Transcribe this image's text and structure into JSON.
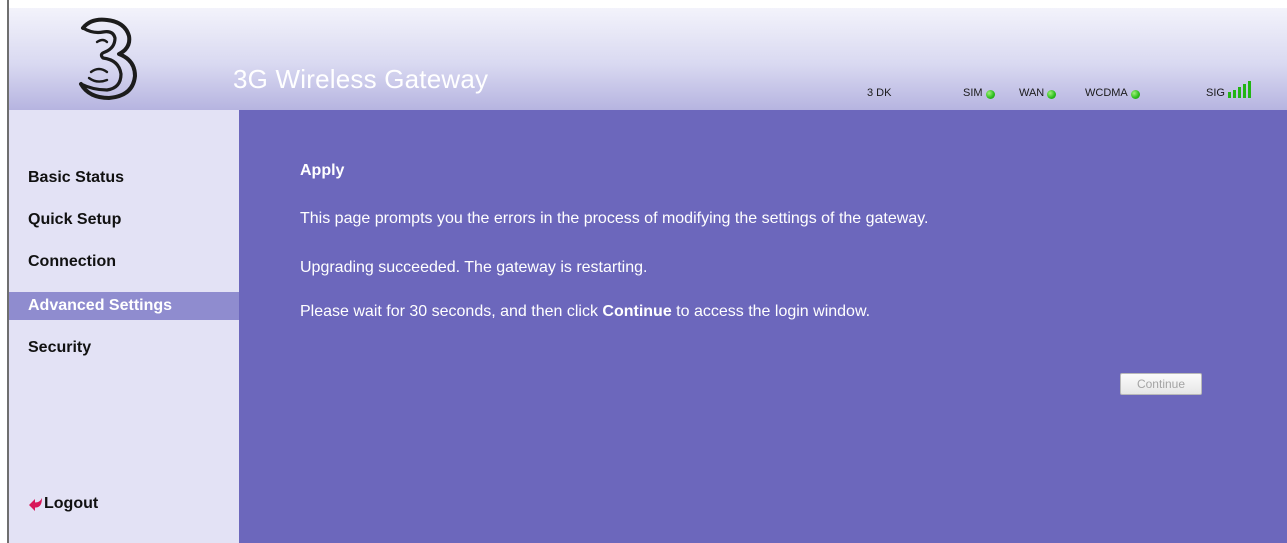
{
  "header": {
    "title": "3G Wireless Gateway",
    "logo": "three-logo",
    "status": {
      "network": "3 DK",
      "sim_label": "SIM",
      "wan_label": "WAN",
      "wcdma_label": "WCDMA",
      "sig_label": "SIG",
      "signal_level": {
        "value": 5,
        "max": 5
      },
      "indicator_color": "#2fc020"
    }
  },
  "sidebar": {
    "items": [
      {
        "label": "Basic Status"
      },
      {
        "label": "Quick Setup"
      },
      {
        "label": "Connection"
      },
      {
        "label": "Advanced Settings",
        "active": true
      },
      {
        "label": "Security"
      }
    ],
    "logout_label": "Logout"
  },
  "content": {
    "title": "Apply",
    "line1": "This page prompts you the errors in the process of modifying the settings of the gateway.",
    "line2": "Upgrading succeeded. The gateway is restarting.",
    "line3_prefix": "Please wait for 30 seconds, and then click ",
    "line3_bold": "Continue",
    "line3_suffix": " to access the login window.",
    "continue_button": "Continue"
  },
  "colors": {
    "content_bg": "#6c67bc",
    "sidebar_bg": "#e3e2f5",
    "active_item": "#8f8ccf",
    "header_gradient_end": "#b6b4e0"
  }
}
